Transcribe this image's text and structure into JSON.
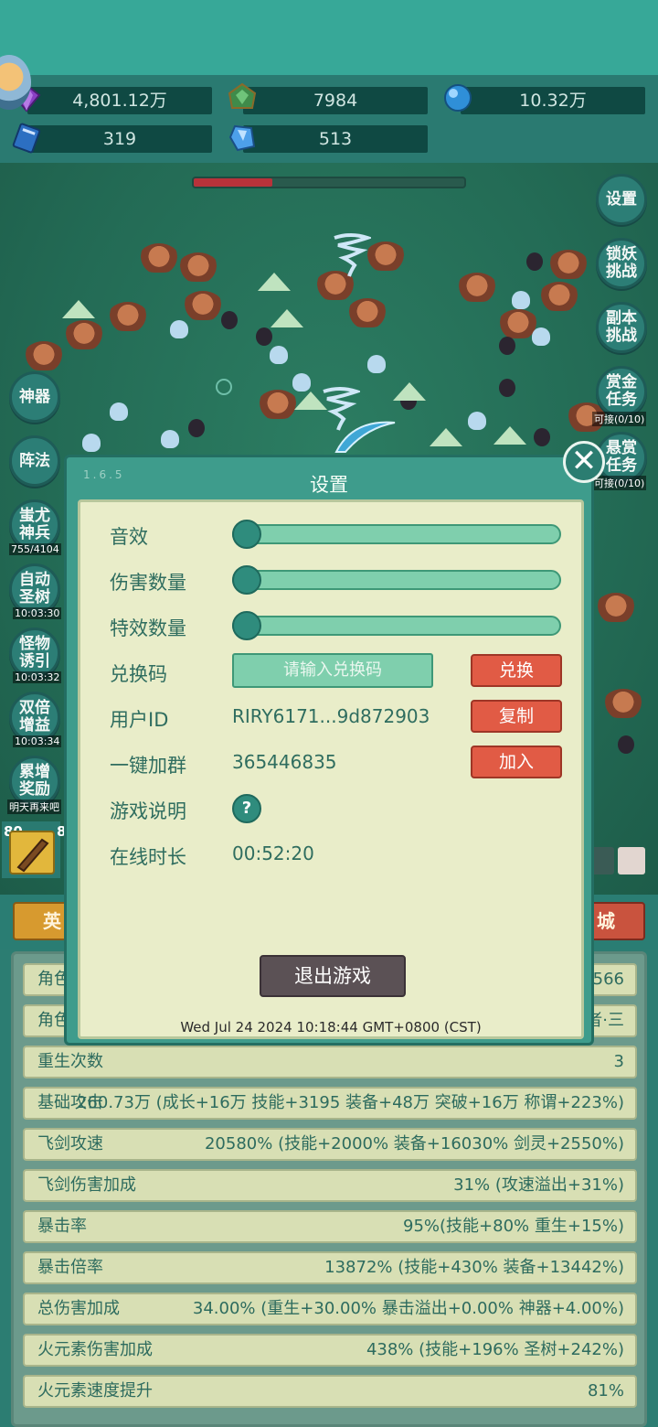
{
  "resources": [
    {
      "icon": "purple-gem-icon",
      "value": "4,801.12万"
    },
    {
      "icon": "green-gem-icon",
      "value": "7984"
    },
    {
      "icon": "blue-orb-icon",
      "value": "10.32万"
    },
    {
      "icon": "blue-book-icon",
      "value": "319"
    },
    {
      "icon": "blue-crystal-icon",
      "value": "513"
    }
  ],
  "boss_hp_fraction": 0.29,
  "right_buttons": [
    {
      "label": "设置"
    },
    {
      "label": "锁妖\n挑战"
    },
    {
      "label": "副本\n挑战"
    },
    {
      "label": "赏金\n任务",
      "sub": "可接(0/10)"
    },
    {
      "label": "悬赏\n任务",
      "sub": "可接(0/10)"
    }
  ],
  "left_buttons": [
    {
      "label": "神器"
    },
    {
      "label": "阵法"
    },
    {
      "label": "蚩尤\n神兵",
      "sub": "755/4104"
    },
    {
      "label": "自动\n圣树",
      "sub": "10:03:30"
    },
    {
      "label": "怪物\n诱引",
      "sub": "10:03:32"
    },
    {
      "label": "双倍\n增益",
      "sub": "10:03:34"
    },
    {
      "label": "累增\n奖励",
      "sub": "明天再来吧"
    }
  ],
  "bottom_tabs": {
    "left": "英",
    "right": "城"
  },
  "partial_levels": {
    "left": "80",
    "left2": "8"
  },
  "stats": [
    {
      "label": "角色",
      "value": "566"
    },
    {
      "label": "角色",
      "value": "者·三"
    },
    {
      "label": "重生次数",
      "value": "3"
    },
    {
      "label": "基础攻击",
      "value": "260.73万 (成长+16万 技能+3195 装备+48万 突破+16万 称谓+223%)"
    },
    {
      "label": "飞剑攻速",
      "value": "20580% (技能+2000% 装备+16030% 剑灵+2550%)"
    },
    {
      "label": "飞剑伤害加成",
      "value": "31% (攻速溢出+31%)"
    },
    {
      "label": "暴击率",
      "value": "95%(技能+80% 重生+15%)"
    },
    {
      "label": "暴击倍率",
      "value": "13872% (技能+430% 装备+13442%)"
    },
    {
      "label": "总伤害加成",
      "value": "34.00% (重生+30.00% 暴击溢出+0.00% 神器+4.00%)"
    },
    {
      "label": "火元素伤害加成",
      "value": "438% (技能+196% 圣树+242%)"
    },
    {
      "label": "火元素速度提升",
      "value": "81%"
    }
  ],
  "dialog": {
    "version": "1.6.5",
    "title": "设置",
    "sound_label": "音效",
    "sound_level": 0,
    "damage_count_label": "伤害数量",
    "damage_count_level": 0,
    "effect_count_label": "特效数量",
    "effect_count_level": 0,
    "redeem_label": "兑换码",
    "redeem_placeholder": "请输入兑换码",
    "redeem_button": "兑换",
    "userid_label": "用户ID",
    "userid_value": "RIRY6171...9d872903",
    "copy_button": "复制",
    "group_label": "一键加群",
    "group_value": "365446835",
    "join_button": "加入",
    "guide_label": "游戏说明",
    "guide_icon": "?",
    "online_label": "在线时长",
    "online_value": "00:52:20",
    "quit_button": "退出游戏",
    "timestamp": "Wed Jul 24 2024 10:18:44 GMT+0800 (CST)"
  }
}
